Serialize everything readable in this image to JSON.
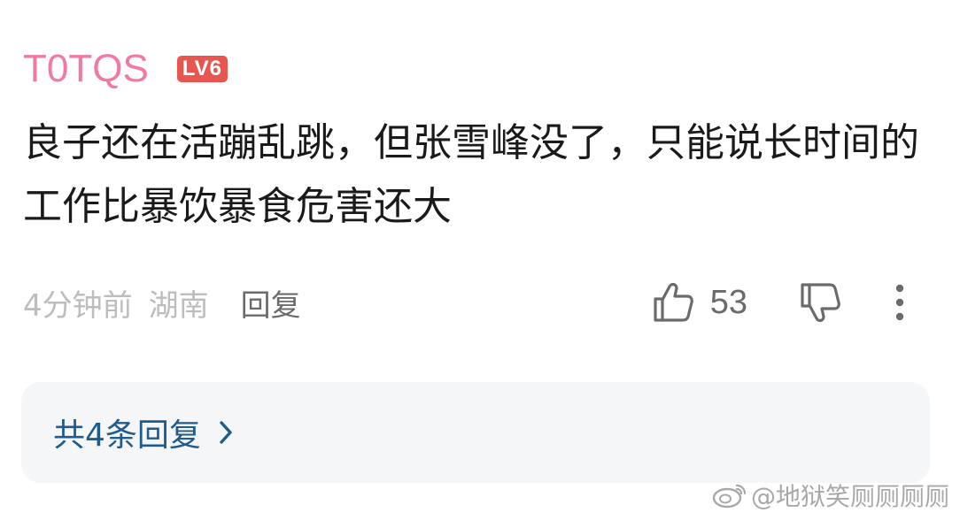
{
  "comment": {
    "username": "T0TQS",
    "level_badge": "LV6",
    "text": "良子还在活蹦乱跳，但张雪峰没了，只能说长时间的工作比暴饮暴食危害还大",
    "time": "4分钟前",
    "location": "湖南",
    "reply_label": "回复",
    "like_count": "53",
    "replies_summary": "共4条回复"
  },
  "watermark": {
    "text": "@地狱笑厕厕厕厕"
  },
  "colors": {
    "username": "#f07aa1",
    "badge_bg": "#e8574f",
    "link_blue": "#1f5b8c",
    "meta_gray": "#bdbdbd",
    "replies_bg": "#f5f6f8"
  },
  "icons": {
    "like": "thumbs-up-icon",
    "dislike": "thumbs-down-icon",
    "more": "more-vertical-icon",
    "chevron": "chevron-right-icon",
    "watermark": "weibo-icon"
  }
}
